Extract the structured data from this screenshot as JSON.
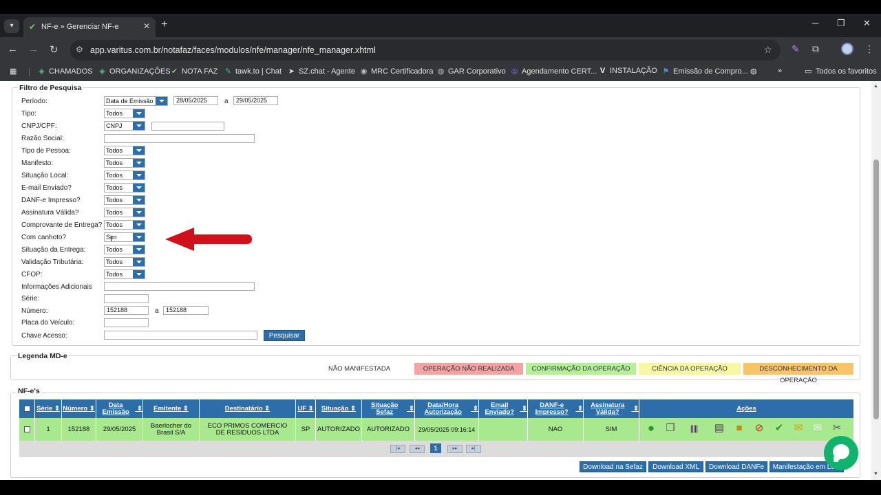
{
  "browser": {
    "tab_title": "NF-e » Gerenciar NF-e",
    "url": "app.varitus.com.br/notafaz/faces/modulos/nfe/manager/nfe_manager.xhtml",
    "bookmarks": [
      "CHAMADOS",
      "ORGANIZAÇÕES",
      "NOTA FAZ",
      "tawk.to | Chat",
      "SZ.chat - Agente",
      "MRC Certificadora",
      "GAR Corporativo",
      "Agendamento CERT...",
      "INSTALAÇÃO",
      "Emissão de Compro..."
    ],
    "all_bookmarks": "Todos os favoritos"
  },
  "filter": {
    "legend": "Filtro de Pesquisa",
    "periodo_label": "Período:",
    "periodo_type": "Data de Emissão",
    "date_from": "28/05/2025",
    "date_to": "29/05/2025",
    "a_text": "a",
    "tipo_label": "Tipo:",
    "tipo_value": "Todos",
    "cnpj_label": "CNPJ/CPF:",
    "cnpj_value": "CNPJ",
    "razao_label": "Razão Social:",
    "tipo_pessoa_label": "Tipo de Pessoa:",
    "tipo_pessoa_value": "Todos",
    "manifesto_label": "Manifesto:",
    "manifesto_value": "Todos",
    "situacao_local_label": "Situação Local:",
    "situacao_local_value": "Todos",
    "email_label": "E-mail Enviado?",
    "email_value": "Todos",
    "danfe_label": "DANF-e Impresso?",
    "danfe_value": "Todos",
    "assinatura_label": "Assinatura Válida?",
    "assinatura_value": "Todos",
    "comprovante_label": "Comprovante de Entrega?",
    "comprovante_value": "Todos",
    "canhoto_label": "Com canhoto?",
    "canhoto_value": "Sim",
    "situacao_entrega_label": "Situação da Entrega:",
    "situacao_entrega_value": "Todos",
    "validacao_label": "Validação Tributária:",
    "validacao_value": "Todos",
    "cfop_label": "CFOP:",
    "cfop_value": "Todos",
    "info_label": "Informações Adicionais",
    "serie_label": "Série:",
    "numero_label": "Número:",
    "numero_from": "152188",
    "numero_to": "152188",
    "placa_label": "Placa do Veículo:",
    "chave_label": "Chave Acesso:",
    "search_button": "Pesquisar"
  },
  "legend_md": {
    "title": "Legenda MD-e",
    "items": [
      {
        "label": "NÃO MANIFESTADA",
        "color": "#ffffff"
      },
      {
        "label": "OPERAÇÃO NÃO REALIZADA",
        "color": "#f4a3a3"
      },
      {
        "label": "CONFIRMAÇÃO DA OPERAÇÃO",
        "color": "#b4f09a"
      },
      {
        "label": "CIÊNCIA DA OPERAÇÃO",
        "color": "#f8f8a4"
      },
      {
        "label": "DESCONHECIMENTO DA OPERAÇÃO",
        "color": "#f8c46a"
      }
    ]
  },
  "nfes": {
    "title": "NF-e's",
    "columns": [
      "Série",
      "Número",
      "Data Emissão",
      "Emitente",
      "Destinatário",
      "UF",
      "Situação",
      "Situação Sefaz",
      "Data/Hora Autorização",
      "Email Enviado?",
      "DANF-e Impresso?",
      "Assinatura Válida?",
      "Ações"
    ],
    "row": {
      "serie": "1",
      "numero": "152188",
      "data_emissao": "29/05/2025",
      "emitente": "Baerlocher do Brasil S/A",
      "destinatario": "ECO PRIMOS COMERCIO DE RESIDUOS LTDA",
      "uf": "SP",
      "situacao": "AUTORIZADO",
      "situacao_sefaz": "AUTORIZADO",
      "data_autorizacao": "29/05/2025 09:16:14",
      "email": "",
      "danfe": "NAO",
      "assinatura": "SIM"
    },
    "current_page": "1",
    "buttons": [
      "Download na Sefaz",
      "Download XML",
      "Download DANFe",
      "Manifestação em Lote"
    ]
  },
  "colors": {
    "primary": "#2d6ea8",
    "row_green": "#a8e88e",
    "annotation_arrow": "#d0111b"
  }
}
